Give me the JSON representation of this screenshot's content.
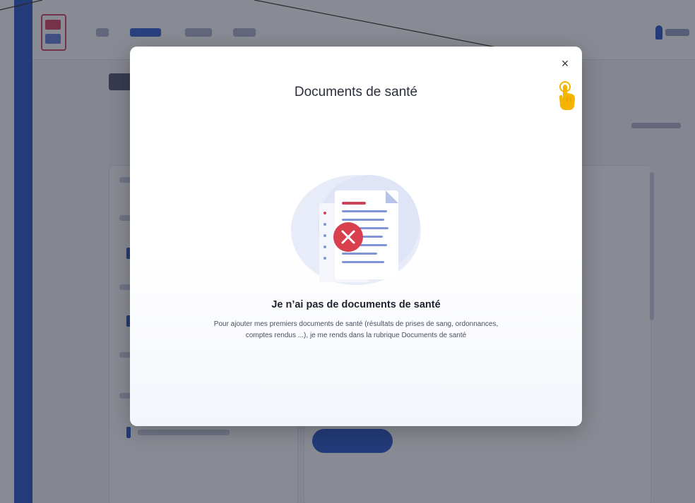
{
  "modal": {
    "title": "Documents de santé",
    "close_glyph": "×",
    "empty_title": "Je n’ai pas de documents de santé",
    "empty_text": "Pour ajouter mes premiers documents de santé (résultats de prises de sang, ordonnances, comptes rendus ...), je me rends dans la rubrique Documents de santé"
  },
  "icons": {
    "close": "close-icon",
    "cursor": "hand-pointer-icon",
    "illustration": "document-error-icon"
  },
  "colors": {
    "accent": "#1d4fc4",
    "error": "#d8404e",
    "cursor": "#f5b400",
    "overlay": "rgba(40, 44, 60, 0.55)"
  }
}
